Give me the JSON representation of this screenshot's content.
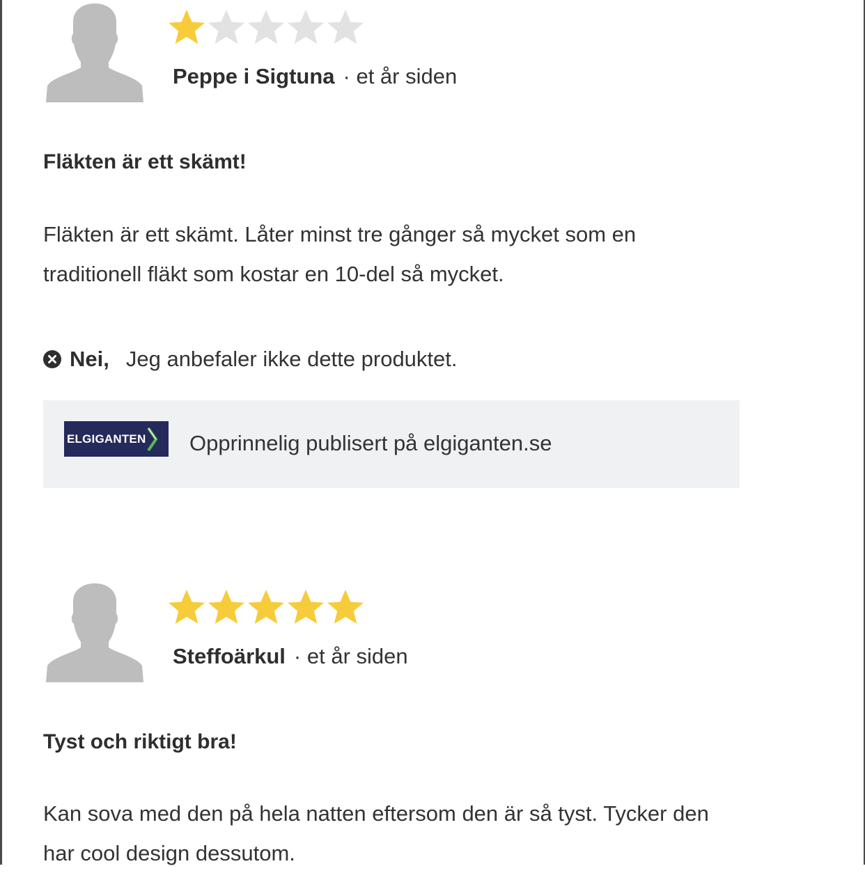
{
  "colors": {
    "star_filled": "#f6cc3b",
    "star_empty": "#e2e2e2",
    "avatar": "#bdbdbd",
    "syndication_bg": "#f0f1f3",
    "store_logo_bg": "#252a5c",
    "store_logo_accent": "#5bb84e"
  },
  "reviews": [
    {
      "rating": 1,
      "rating_max": 5,
      "author": "Peppe i Sigtuna",
      "time": "· et år siden",
      "title": "Fläkten är ett skämt!",
      "body": "Fläkten är ett skämt. Låter minst tre gånger så mycket som en traditionell fläkt som kostar en 10-del så mycket.",
      "recommend_label": "Nei,",
      "recommend_text": "Jeg anbefaler ikke dette produktet.",
      "recommend_icon": "x-circle-icon",
      "syndication": {
        "logo_text": "ELGIGANTEN",
        "text": "Opprinnelig publisert på elgiganten.se"
      }
    },
    {
      "rating": 5,
      "rating_max": 5,
      "author": "Steffoärkul",
      "time": "· et år siden",
      "title": "Tyst och riktigt bra!",
      "body": "Kan sova med den på hela natten eftersom den är så tyst. Tycker den har cool design dessutom."
    }
  ]
}
